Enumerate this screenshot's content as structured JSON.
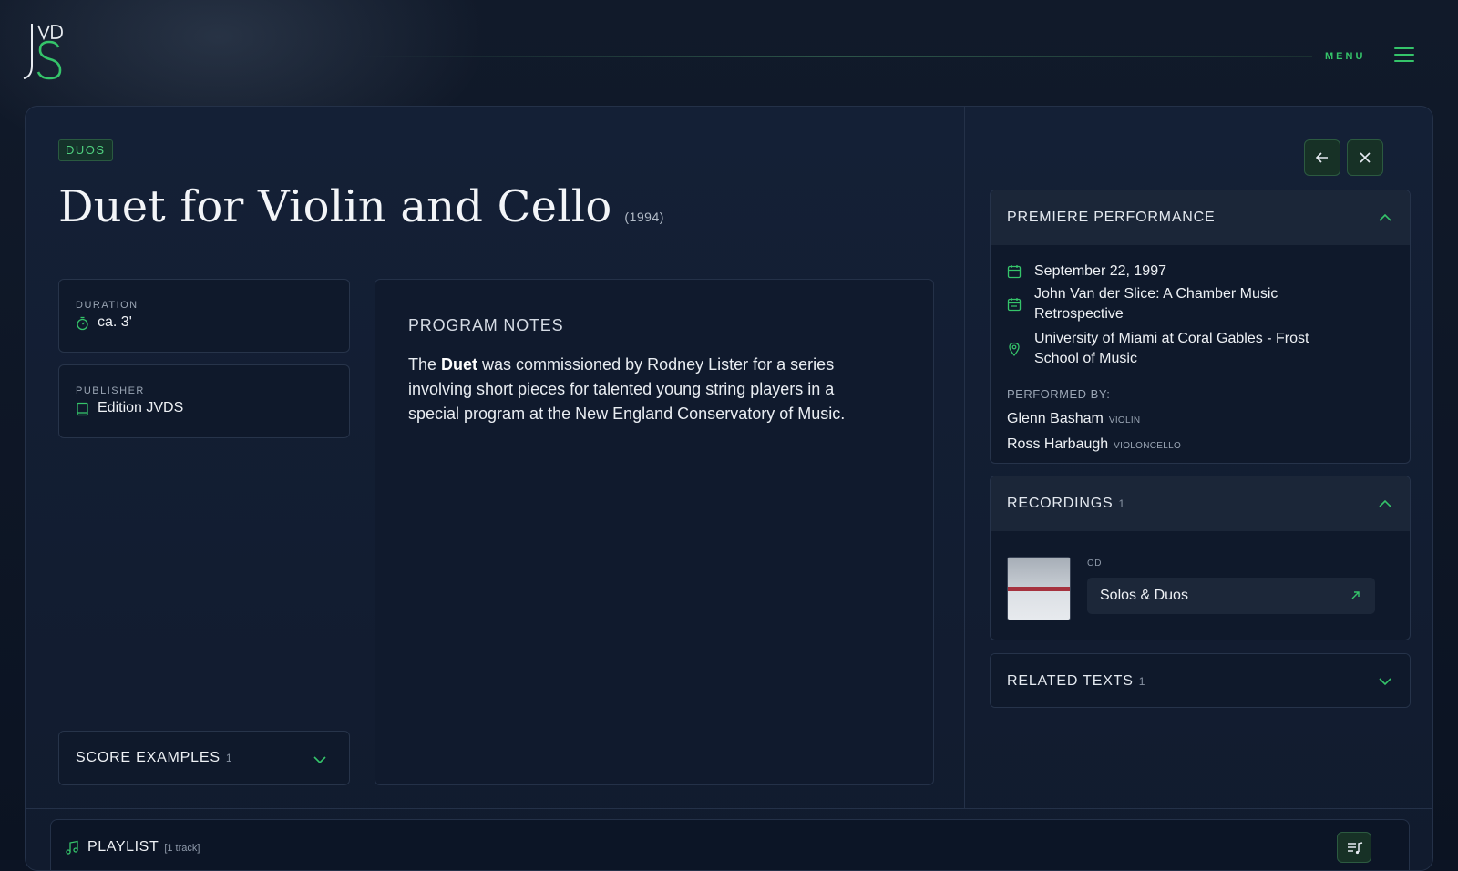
{
  "header": {
    "menu_label": "MENU"
  },
  "work": {
    "category": "DUOS",
    "title": "Duet for Violin and Cello",
    "year": "(1994)",
    "duration_label": "DURATION",
    "duration": "ca. 3'",
    "publisher_label": "PUBLISHER",
    "publisher": "Edition JVDS"
  },
  "score_examples": {
    "label": "SCORE EXAMPLES",
    "count": "1"
  },
  "program_notes": {
    "heading": "PROGRAM NOTES",
    "text_before": "The ",
    "text_bold": "Duet",
    "text_after": " was commissioned by Rodney Lister for a series involving short pieces for talented young string players in a special program at the New England Conservatory of Music."
  },
  "premiere": {
    "heading": "PREMIERE PERFORMANCE",
    "date": "September 22, 1997",
    "event": "John Van der Slice: A Chamber Music Retrospective",
    "venue": "University of Miami at Coral Gables - Frost School of Music",
    "performed_by_label": "PERFORMED BY:",
    "performers": [
      {
        "name": "Glenn Basham",
        "instrument": "VIOLIN"
      },
      {
        "name": "Ross Harbaugh",
        "instrument": "VIOLONCELLO"
      }
    ]
  },
  "recordings": {
    "heading": "RECORDINGS",
    "count": "1",
    "items": [
      {
        "format": "CD",
        "title": "Solos & Duos"
      }
    ]
  },
  "related_texts": {
    "heading": "RELATED TEXTS",
    "count": "1"
  },
  "playlist": {
    "label": "PLAYLIST",
    "meta": "[1 track]"
  },
  "colors": {
    "accent": "#35c46a",
    "background": "#0c1424",
    "panel": "#142036"
  }
}
